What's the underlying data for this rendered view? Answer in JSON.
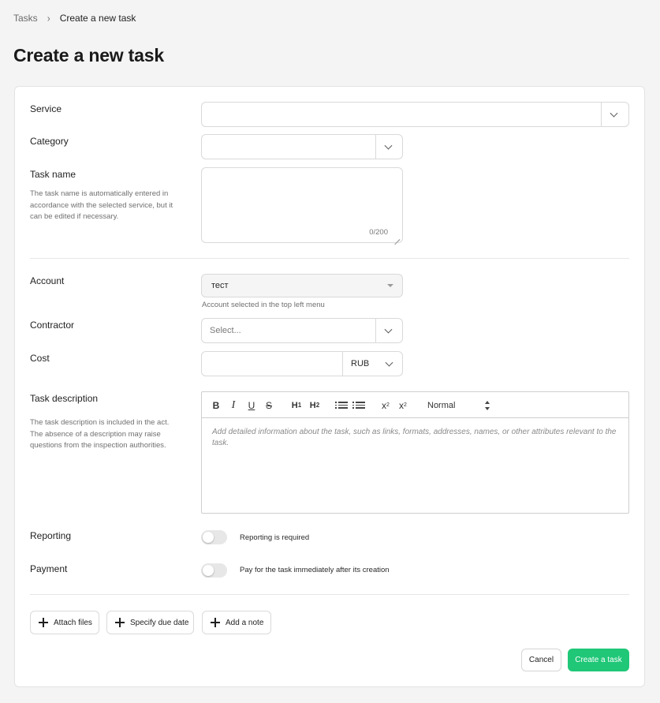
{
  "breadcrumb": {
    "root": "Tasks",
    "separator": "›",
    "current": "Create a new task"
  },
  "page": {
    "title": "Create a new task"
  },
  "form": {
    "service": {
      "label": "Service",
      "value": ""
    },
    "category": {
      "label": "Category",
      "value": ""
    },
    "task_name": {
      "label": "Task name",
      "hint": "The task name is automatically entered in accordance with the selected service, but it can be edited if necessary.",
      "value": "",
      "counter": "0/200"
    },
    "account": {
      "label": "Account",
      "value": "тест",
      "hint": "Account selected in the top left menu"
    },
    "contractor": {
      "label": "Contractor",
      "placeholder": "Select..."
    },
    "cost": {
      "label": "Cost",
      "value": "",
      "currency": "RUB"
    },
    "task_description": {
      "label": "Task description",
      "hint": "The task description is included in the act. The absence of a description may raise questions from the inspection authorities.",
      "placeholder": "Add detailed information about the task, such as links, formats, addresses, names, or other attributes relevant to the task.",
      "toolbar": {
        "bold": "B",
        "italic": "I",
        "underline": "U",
        "strike": "S",
        "h1": "H",
        "h1_sub": "1",
        "h2": "H",
        "h2_sub": "2",
        "subscript": "x",
        "subscript_mark": "2",
        "superscript": "x",
        "superscript_mark": "2",
        "format": "Normal"
      }
    },
    "reporting": {
      "label": "Reporting",
      "toggle_text": "Reporting is required",
      "enabled": false
    },
    "payment": {
      "label": "Payment",
      "toggle_text": "Pay for the task immediately after its creation",
      "enabled": false
    }
  },
  "actions": {
    "attach_files": "Attach files",
    "specify_due_date": "Specify due date",
    "add_note": "Add a note",
    "cancel": "Cancel",
    "create": "Create a task"
  },
  "colors": {
    "primary": "#1fc777",
    "background": "#f4f4f4"
  }
}
